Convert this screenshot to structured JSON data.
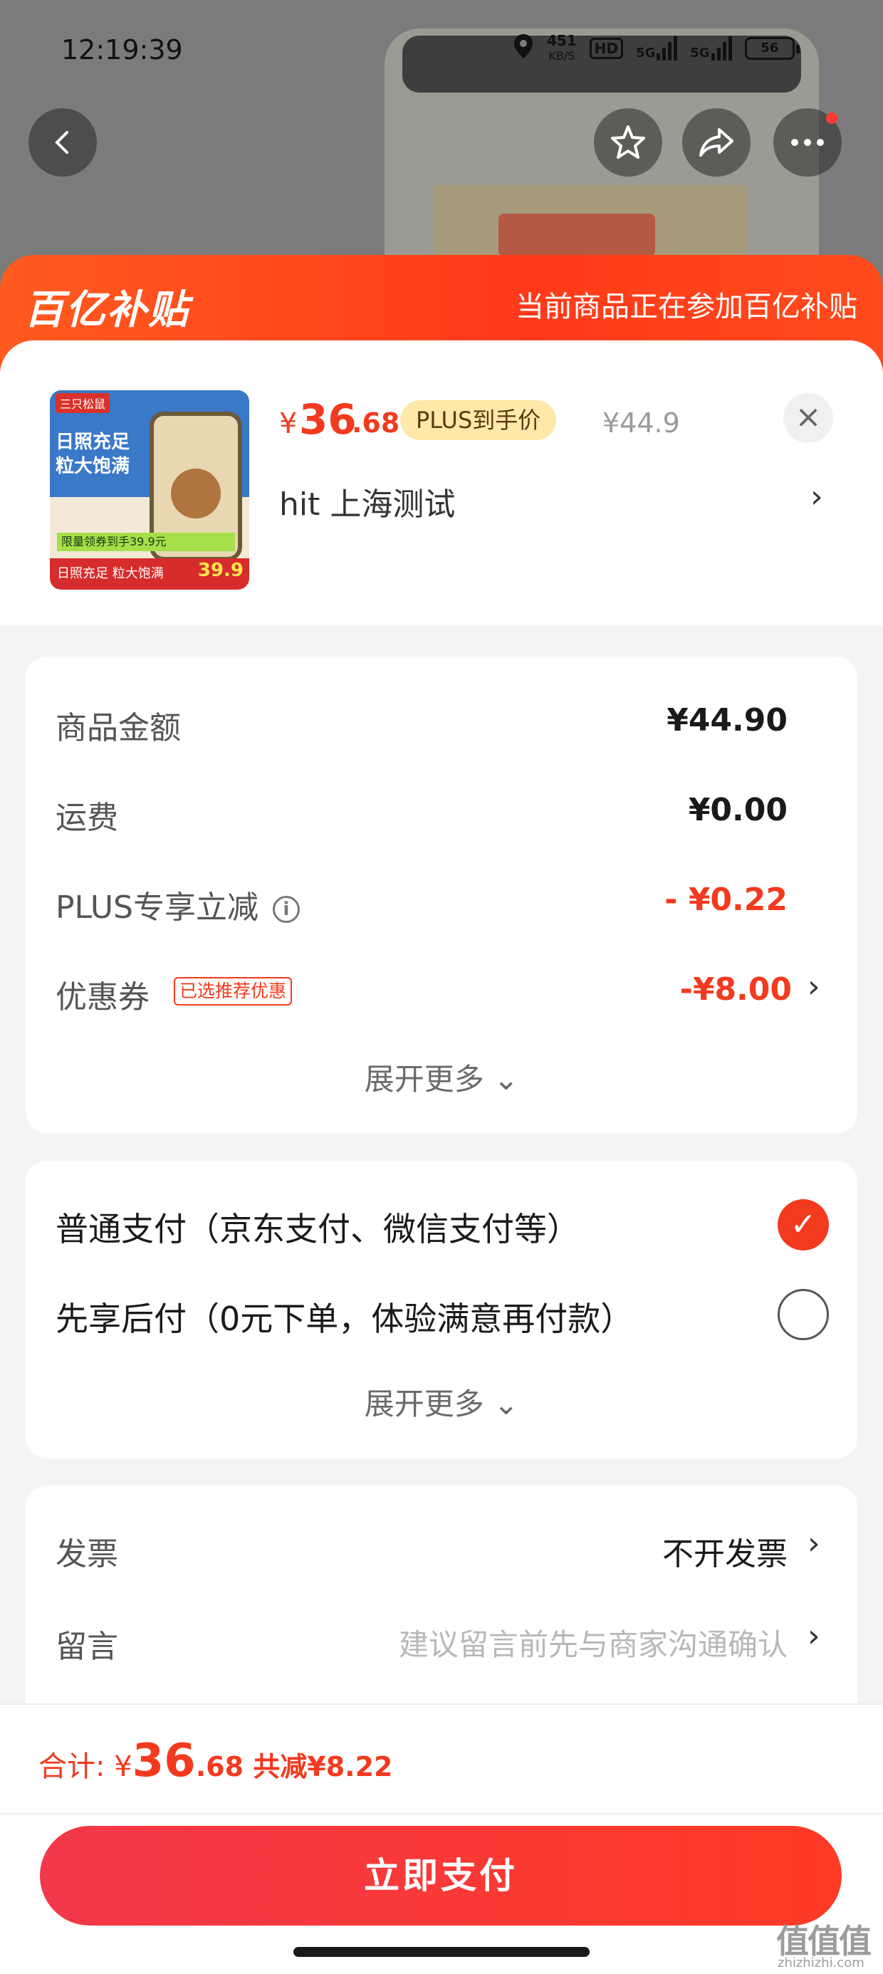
{
  "status_bar": {
    "time": "12:19:39",
    "net_speed_value": "451",
    "net_speed_unit": "KB/S",
    "hd": "HD",
    "signal1": "5G",
    "signal2": "5G",
    "battery": "56"
  },
  "promo": {
    "logo_text": "百亿补贴",
    "banner_text": "当前商品正在参加百亿补贴"
  },
  "product": {
    "image": {
      "brand": "三只松鼠",
      "title_line1": "日照充足",
      "title_line2": "粒大饱满",
      "green_strip": "限量领券到手39.9元",
      "bottom_text": "日照充足 粒大饱满",
      "bottom_price": "39.9"
    },
    "currency": "¥",
    "price_int": "36",
    "price_dec": ".68",
    "plus_tag": "PLUS到手价",
    "original_price": "¥44.9",
    "close": "×",
    "address": "hit  上海测试",
    "chevron": "›"
  },
  "summary": {
    "rows": [
      {
        "label": "商品金额",
        "value": "¥44.90"
      },
      {
        "label": "运费",
        "value": "¥0.00"
      },
      {
        "label": "PLUS专享立减",
        "value": "- ¥0.22"
      },
      {
        "label": "优惠券",
        "value": "-¥8.00",
        "tag": "已选推荐优惠"
      }
    ],
    "info_icon": "i",
    "expand": "展开更多 ⌄"
  },
  "payment": {
    "options": [
      {
        "label": "普通支付（京东支付、微信支付等）",
        "selected": true
      },
      {
        "label": "先享后付（0元下单，体验满意再付款）",
        "selected": false
      }
    ],
    "check": "✓",
    "expand": "展开更多 ⌄"
  },
  "extras": {
    "invoice_label": "发票",
    "invoice_value": "不开发票",
    "message_label": "留言",
    "message_placeholder": "建议留言前先与商家沟通确认"
  },
  "footer": {
    "total_label": "合计: ",
    "total_currency": "¥",
    "total_int": "36",
    "total_dec": ".68",
    "discount": " 共减¥8.22",
    "pay_button": "立即支付"
  },
  "watermark": {
    "logo": "值值值",
    "url": "zhizhizhi.com"
  },
  "colors": {
    "accent": "#f23a1f",
    "promo_bar": "#ff4a1c",
    "plus_tag_bg": "#ffe8a8"
  }
}
